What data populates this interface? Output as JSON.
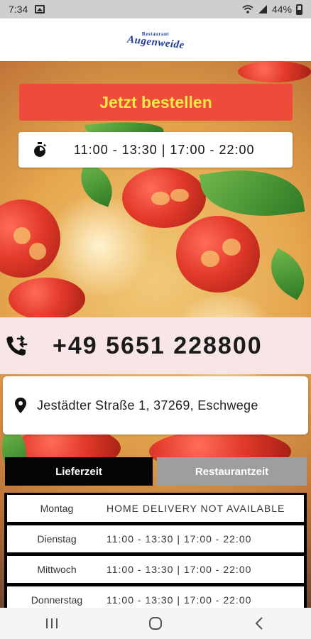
{
  "status_bar": {
    "time": "7:34",
    "battery": "44%"
  },
  "header": {
    "logo_small": "Restaurant",
    "logo_main": "Augenweide"
  },
  "order_button": {
    "label": "Jetzt bestellen",
    "bg_color": "#ef4b3a",
    "text_color": "#f6e54b"
  },
  "opening_hours": "11:00 - 13:30 | 17:00 - 22:00",
  "phone": "+49 5651 228800",
  "address": "Jestädter Straße 1, 37269, Eschwege",
  "tabs": [
    {
      "label": "Lieferzeit",
      "active": true
    },
    {
      "label": "Restaurantzeit",
      "active": false
    }
  ],
  "schedule": [
    {
      "day": "Montag",
      "hours": "HOME DELIVERY NOT AVAILABLE"
    },
    {
      "day": "Dienstag",
      "hours": "11:00 - 13:30 | 17:00 - 22:00"
    },
    {
      "day": "Mittwoch",
      "hours": "11:00 - 13:30 | 17:00 - 22:00"
    },
    {
      "day": "Donnerstag",
      "hours": "11:00 - 13:30 | 17:00 - 22:00"
    }
  ],
  "icons": {
    "timer": "stopwatch-icon",
    "phone": "phone-forward-icon",
    "location": "location-pin-icon",
    "nav_recents": "recents-icon",
    "nav_home": "home-icon",
    "nav_back": "back-icon"
  }
}
